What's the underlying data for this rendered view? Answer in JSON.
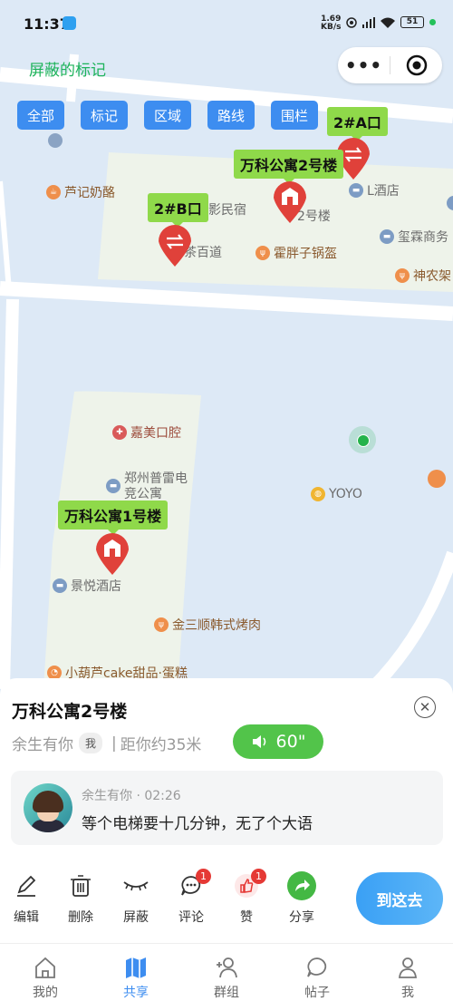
{
  "status_bar": {
    "time": "11:37",
    "speed_value": "1.69",
    "speed_unit": "KB/s",
    "battery": "51"
  },
  "page_title": "屏蔽的标记",
  "filters": [
    "全部",
    "标记",
    "区域",
    "路线",
    "围栏"
  ],
  "pins": {
    "a_exit": "2#A口",
    "b_exit": "2#B口",
    "building2": "万科公寓2号楼",
    "building1": "万科公寓1号楼"
  },
  "map_labels": {
    "luji": "芦记奶酪",
    "l_hotel": "L酒店",
    "yingminsu": "观影民宿",
    "building2_small": "2号楼",
    "chabaidao": "茶百道",
    "huopangzi": "霍胖子锅盔",
    "xilin": "玺霖商务",
    "shennong": "神农架",
    "jiamei": "嘉美口腔",
    "pulei": "郑州普雷电竞公寓",
    "pulei_line1": "郑州普雷电",
    "pulei_line2": "竞公寓",
    "yoyo": "YOYO",
    "jingyue": "景悦酒店",
    "jinsanshun": "金三顺韩式烤肉",
    "xiaohulu": "小葫芦cake甜品·蛋糕"
  },
  "sheet": {
    "title": "万科公寓2号楼",
    "author": "余生有你",
    "me_tag": "我",
    "separator": "|",
    "distance": "距你约35米",
    "voice_duration": "60\"",
    "comment": {
      "author": "余生有你",
      "dot": "·",
      "time": "02:26",
      "text": "等个电梯要十几分钟，无了个大语"
    }
  },
  "actions": {
    "edit": "编辑",
    "delete": "删除",
    "block": "屏蔽",
    "comment": "评论",
    "comment_count": "1",
    "like": "赞",
    "like_count": "1",
    "share": "分享",
    "go_here": "到这去"
  },
  "tabs": [
    "我的",
    "共享",
    "群组",
    "帖子",
    "我"
  ],
  "active_tab": "共享",
  "colors": {
    "accent_blue": "#3d8df0",
    "pin_red": "#e0413a",
    "label_green": "#8fd94a",
    "title_green": "#1eb35b",
    "voice_green": "#52c44a"
  }
}
